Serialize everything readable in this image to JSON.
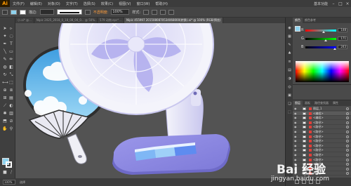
{
  "app": {
    "logo": "Ai"
  },
  "menu": [
    "文件(F)",
    "编辑(E)",
    "对象(O)",
    "文字(T)",
    "选择(S)",
    "效果(C)",
    "视图(V)",
    "窗口(W)",
    "帮助(H)"
  ],
  "workspace": "基本功能",
  "window_controls": [
    "–",
    "□",
    "×"
  ],
  "control_bar": {
    "stroke_label": "描边:",
    "stroke_value": "",
    "profile_label": "不透明度:",
    "opacity_value": "100%",
    "style_label": "样式:"
  },
  "document_tabs": [
    {
      "label": "小.ai* @...",
      "active": false
    },
    {
      "label": "Nipic 2025_2018_0_18_08_04_0... @ 50%...",
      "active": false
    },
    {
      "label": "579 动物.eps*...",
      "active": false
    },
    {
      "label": "Nipic 455997 2015080870534068000(转换).ai* @ 100% (RGB/预览)",
      "active": true
    }
  ],
  "status_bar": {
    "zoom": "100%",
    "text": "选择"
  },
  "color_panel": {
    "tabs": [
      "颜色",
      "颜色参考"
    ],
    "sliders": [
      {
        "label": "R",
        "value": "148",
        "fraction": 0.58,
        "gradient": [
          "#ff0000",
          "#00ffff"
        ]
      },
      {
        "label": "G",
        "value": "171",
        "fraction": 0.67,
        "gradient": [
          "#000000",
          "#00ff00"
        ]
      },
      {
        "label": "B",
        "value": "243",
        "fraction": 0.95,
        "gradient": [
          "#000000",
          "#0000ff"
        ]
      }
    ]
  },
  "layers_panel": {
    "tabs": [
      "图层",
      "画板",
      "路径查找器",
      "属性"
    ],
    "rows": [
      {
        "name": "图层_1"
      },
      {
        "name": "<编组>"
      },
      {
        "name": "<编组>"
      },
      {
        "name": "<路径>"
      },
      {
        "name": "<路径>"
      },
      {
        "name": "<路径>"
      },
      {
        "name": "<路径>"
      },
      {
        "name": "<路径>"
      },
      {
        "name": "<路径>"
      },
      {
        "name": "<路径>"
      },
      {
        "name": "<路径>"
      },
      {
        "name": "<路径>"
      },
      {
        "name": "<路径>"
      },
      {
        "name": "<路径>"
      },
      {
        "name": "<路径>"
      }
    ],
    "selected_index": 1
  },
  "watermark": {
    "brand": "Bai 经验",
    "url": "jingyan.baidu.com"
  },
  "colors": {
    "fill": "#8fd3ef",
    "fan_blue": "#a7a2ee",
    "fan_white": "#f2f2fa",
    "hand_fan_blue": "#3fa4e2",
    "sky": "#9fd9f6"
  }
}
